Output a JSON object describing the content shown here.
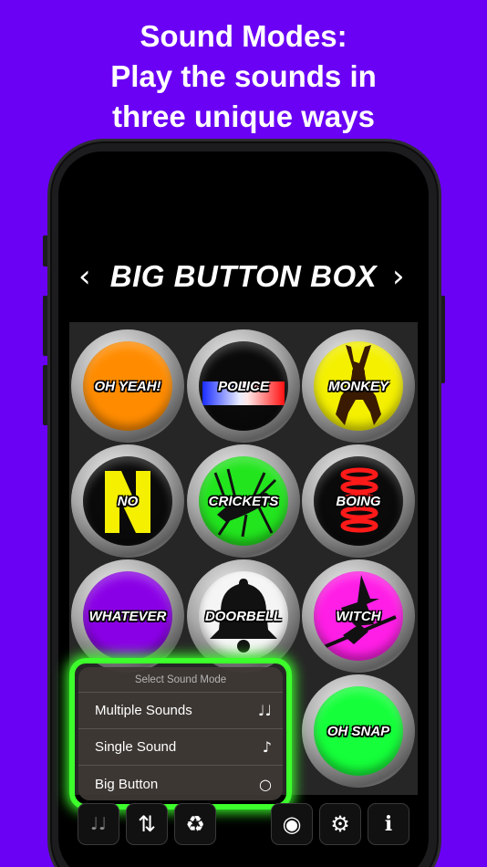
{
  "headline": {
    "line1": "Sound Modes:",
    "line2": "Play the sounds in",
    "line3": "three unique ways"
  },
  "app": {
    "title": "BIG BUTTON BOX",
    "prev_glyph": "‹",
    "next_glyph": "›"
  },
  "buttons": [
    {
      "label": "OH YEAH!",
      "color": "#ff8c00",
      "icon": "none"
    },
    {
      "label": "POLICE",
      "color": "#0a0a0a",
      "icon": "police-lights"
    },
    {
      "label": "MONKEY",
      "color": "#f4f000",
      "icon": "monkey"
    },
    {
      "label": "NO",
      "color": "#0a0a0a",
      "icon": "letter-n"
    },
    {
      "label": "CRICKETS",
      "color": "#22e51e",
      "icon": "cricket"
    },
    {
      "label": "BOING",
      "color": "#0a0a0a",
      "icon": "spring"
    },
    {
      "label": "WHATEVER",
      "color": "#8a00e6",
      "icon": "none"
    },
    {
      "label": "DOORBELL",
      "color": "#f5f5f5",
      "icon": "bell"
    },
    {
      "label": "WITCH",
      "color": "#ff1ee6",
      "icon": "witch"
    },
    {
      "label": "OH SNAP",
      "color": "#15ff3a",
      "icon": "none"
    }
  ],
  "sound_mode_menu": {
    "heading": "Select Sound Mode",
    "items": [
      {
        "label": "Multiple Sounds",
        "icon": "♩♩"
      },
      {
        "label": "Single Sound",
        "icon": "♪"
      },
      {
        "label": "Big Button",
        "icon": "○"
      }
    ],
    "highlight_color": "#3cff2c"
  },
  "toolbar": {
    "multi_sound_icon": "♩♩",
    "sort_icon": "⇅",
    "recycle_icon": "♻",
    "record_icon": "◉",
    "settings_icon": "⚙",
    "info_icon": "i"
  }
}
